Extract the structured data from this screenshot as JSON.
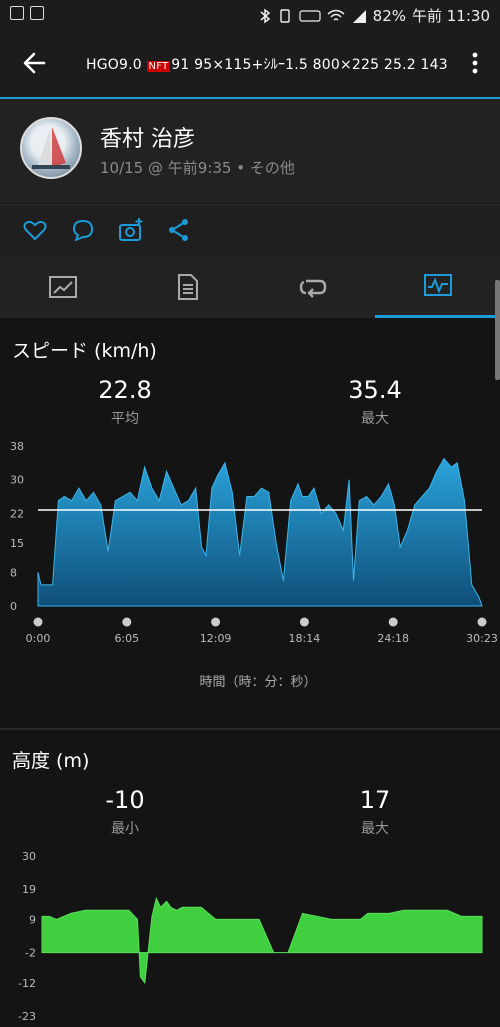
{
  "status_bar": {
    "battery": "82%",
    "time": "午前 11:30"
  },
  "header": {
    "title_prefix": "HGO9.0 ",
    "badge": "NFT",
    "title_rest": "91  95×115+ｼﾙｰ1.5   800×225  25.2  143"
  },
  "profile": {
    "name": "香村 治彦",
    "meta": "10/15 @ 午前9:35 • その他"
  },
  "speed": {
    "title": "スピード (km/h)",
    "avg_value": "22.8",
    "avg_label": "平均",
    "max_value": "35.4",
    "max_label": "最大",
    "x_axis_label": "時間（時：分：秒）"
  },
  "altitude": {
    "title": "高度 (m)",
    "min_value": "-10",
    "min_label": "最小",
    "max_value": "17",
    "max_label": "最大"
  },
  "colors": {
    "accent": "#1b9bd8",
    "speed_fill_top": "#2aa3db",
    "speed_fill_bottom": "#0f4e78",
    "altitude_fill": "#3fcf3f",
    "avg_line": "#ffffff"
  },
  "chart_data": [
    {
      "type": "area",
      "title": "スピード (km/h)",
      "xlabel": "時間（時：分：秒）",
      "ylabel": "",
      "ylim": [
        0,
        38
      ],
      "y_ticks": [
        "0",
        "8",
        "15",
        "22",
        "30",
        "38"
      ],
      "x_ticks": [
        "0:00",
        "6:05",
        "12:09",
        "18:14",
        "24:18",
        "30:23"
      ],
      "average": 22.8,
      "series": [
        {
          "x": [
            0.0,
            0.2,
            0.5,
            1.0,
            1.4,
            1.8,
            2.3,
            2.8,
            3.3,
            3.8,
            4.3,
            4.8,
            5.3,
            5.8,
            6.3,
            6.8,
            7.3,
            7.8,
            8.3,
            8.8,
            9.3,
            9.8,
            10.3,
            10.8,
            11.2,
            11.5,
            11.9,
            12.3,
            12.8,
            13.3,
            13.8,
            14.3,
            14.8,
            15.3,
            15.8,
            16.3,
            16.8,
            17.3,
            17.8,
            18.1,
            18.5,
            18.9,
            19.4,
            19.9,
            20.4,
            20.9,
            21.3,
            21.6,
            22.0,
            22.5,
            23.0,
            23.5,
            24.0,
            24.4,
            24.8,
            25.3,
            25.8,
            26.3,
            26.8,
            27.3,
            27.8,
            28.3,
            28.7,
            29.2,
            29.7,
            30.2,
            30.4
          ],
          "y": [
            8,
            5,
            5,
            5,
            25,
            26,
            25,
            28,
            25,
            27,
            24,
            13,
            25,
            26,
            27,
            25,
            33,
            28,
            25,
            32,
            28,
            24,
            25,
            28,
            14,
            12,
            28,
            31,
            34,
            27,
            12,
            26,
            26,
            28,
            27,
            15,
            6,
            25,
            29,
            26,
            26,
            28,
            22,
            24,
            22,
            18,
            30,
            6,
            25,
            26,
            24,
            26,
            29,
            24,
            14,
            18,
            24,
            26,
            28,
            32,
            35,
            33,
            34,
            25,
            5,
            2,
            0
          ]
        }
      ]
    },
    {
      "type": "area",
      "title": "高度 (m)",
      "xlabel": "",
      "ylabel": "",
      "ylim": [
        -23,
        30
      ],
      "y_ticks": [
        "-23",
        "-12",
        "-2",
        "9",
        "19",
        "30"
      ],
      "series": [
        {
          "x": [
            0.0,
            0.5,
            1.0,
            2.0,
            3.0,
            4.0,
            5.0,
            6.0,
            6.6,
            6.8,
            7.1,
            7.3,
            7.6,
            7.9,
            8.2,
            8.6,
            8.9,
            9.3,
            9.7,
            10.2,
            11.0,
            12.0,
            13.0,
            14.0,
            15.0,
            16.0,
            16.5,
            17.0,
            18.0,
            19.0,
            20.0,
            21.0,
            22.0,
            22.5,
            23.0,
            24.0,
            25.0,
            26.0,
            27.0,
            28.0,
            29.0,
            29.6,
            30.4
          ],
          "y": [
            10,
            10,
            9,
            11,
            12,
            12,
            12,
            12,
            9,
            -10,
            -12,
            -3,
            10,
            16,
            13,
            15,
            13,
            12,
            13,
            13,
            13,
            9,
            9,
            9,
            9,
            -2,
            -2,
            -2,
            11,
            10,
            9,
            9,
            9,
            11,
            11,
            11,
            12,
            12,
            12,
            12,
            10,
            10,
            10
          ]
        }
      ]
    }
  ]
}
